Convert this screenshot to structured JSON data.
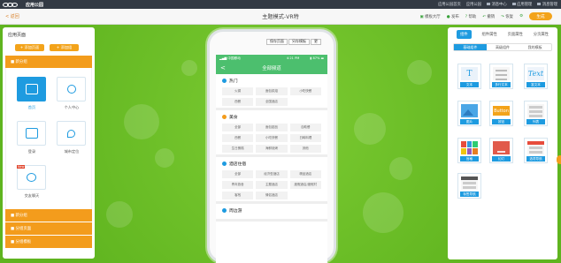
{
  "app": {
    "brand": "应用公园",
    "brand_sub": "yingyong.io",
    "sys_links": [
      "应用公园首页",
      "应用公园",
      "消息中心",
      "应用管理",
      "消息管理"
    ]
  },
  "titlebar": {
    "back": "< 返回",
    "title": "主题模式-VR特",
    "links": [
      "模板大厅",
      "发布",
      "帮助",
      "撤销",
      "恢复"
    ],
    "generate": "生成"
  },
  "left_panel": {
    "title": "应用页面",
    "buttons": [
      "+ 添加页面",
      "+ 添加组"
    ],
    "groups_top": [
      "■ 新分组"
    ],
    "tiles": [
      {
        "label": "首页",
        "selected": true
      },
      {
        "label": "个人中心",
        "selected": false
      },
      {
        "label": "登录",
        "selected": false
      },
      {
        "label": "城市定位",
        "selected": false
      },
      {
        "label": "交友聊天",
        "selected": false,
        "tag": "New"
      }
    ],
    "groups_bottom": [
      "■ 新分组",
      "■ 分组页面",
      "■ 分组模板"
    ]
  },
  "phone": {
    "top_buttons": [
      "保存页面",
      "另存模板",
      "更"
    ],
    "statusbar": {
      "carrier": "▂▄▆ 中国移动",
      "time": "4:21 PM",
      "battery": "▮ 87% ▬"
    },
    "nav": {
      "back": "<",
      "title": "全部频道"
    },
    "sections": [
      {
        "title": "热门",
        "color": "#1e9be0",
        "chips": [
          "火锅",
          "面包烘焙",
          "小吃快餐",
          "西餐",
          "全国酒店"
        ]
      },
      {
        "title": "美食",
        "color": "#f39c1c",
        "chips": [
          "全部",
          "面包甜品",
          "自助餐",
          "西餐",
          "小吃快餐",
          "日韩料理",
          "生日蛋糕",
          "海鲜烧烤",
          "其他"
        ]
      },
      {
        "title": "酒店住宿",
        "color": "#1e9be0",
        "chips": [
          "全部",
          "经济型酒店",
          "精品酒店",
          "青年旅舍",
          "主题酒店",
          "度假酒店/度假村",
          "客栈",
          "情侣酒店"
        ]
      },
      {
        "title": "周边游",
        "color": "#1e9be0",
        "chips": []
      }
    ]
  },
  "right_panel": {
    "tabs": [
      "组件",
      "组件属性",
      "页面属性",
      "分页属性"
    ],
    "subtabs": [
      "基础组件",
      "高级组件",
      "我的模板"
    ],
    "components": [
      {
        "label": "文本",
        "art": "text"
      },
      {
        "label": "多行文本",
        "art": "multitext"
      },
      {
        "label": "富文本",
        "art": "richtext"
      },
      {
        "label": "图片",
        "art": "image"
      },
      {
        "label": "按钮",
        "art": "button"
      },
      {
        "label": "列表",
        "art": "list"
      },
      {
        "label": "宫格",
        "art": "grid"
      },
      {
        "label": "幻灯",
        "art": "slide"
      },
      {
        "label": "选项导航",
        "art": "tabnav"
      },
      {
        "label": "标签导航",
        "art": "tagnav"
      }
    ]
  }
}
